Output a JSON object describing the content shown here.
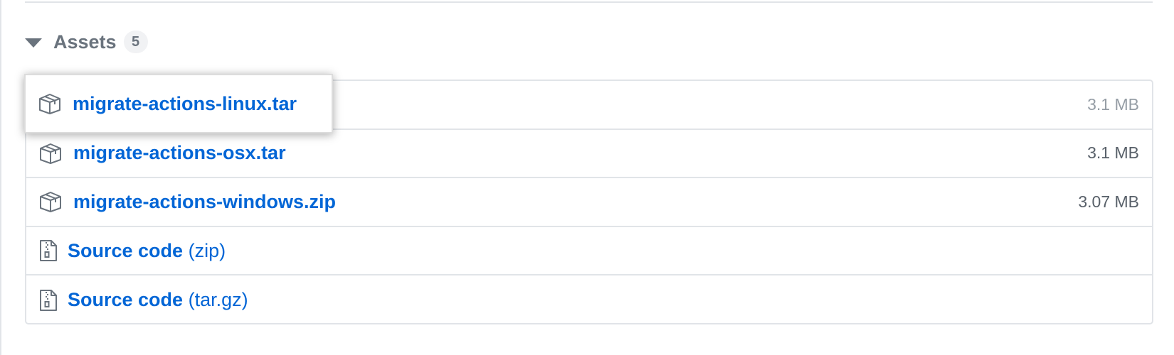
{
  "assets": {
    "title": "Assets",
    "count": "5",
    "items": [
      {
        "name": "migrate-actions-linux.tar",
        "size": "3.1 MB",
        "icon": "package-icon"
      },
      {
        "name": "migrate-actions-osx.tar",
        "size": "3.1 MB",
        "icon": "package-icon"
      },
      {
        "name": "migrate-actions-windows.zip",
        "size": "3.07 MB",
        "icon": "package-icon"
      },
      {
        "name": "Source code",
        "suffix": "(zip)",
        "icon": "file-zip-icon"
      },
      {
        "name": "Source code",
        "suffix": "(tar.gz)",
        "icon": "file-zip-icon"
      }
    ]
  },
  "colors": {
    "link": "#0366d6",
    "muted": "#6a737d",
    "border": "#e1e4e8"
  }
}
